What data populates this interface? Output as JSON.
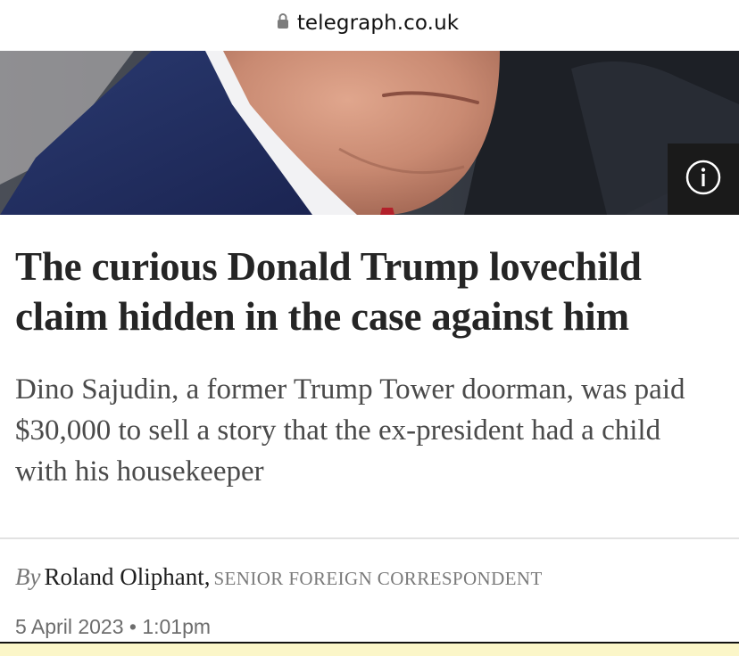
{
  "browser": {
    "url": "telegraph.co.uk"
  },
  "hero": {
    "image_icon": "info-icon"
  },
  "article": {
    "headline": "The curious Donald Trump lovechild claim hidden in the case against him",
    "standfirst": "Dino Sajudin, a former Trump Tower doorman, was paid $30,000 to sell a story that the ex-president had a child with his housekeeper",
    "byline_prefix": "By",
    "author": "Roland Oliphant,",
    "author_role": "Senior Foreign Correspondent",
    "date": "5 April 2023",
    "separator": " • ",
    "time": "1:01pm"
  },
  "colors": {
    "headline": "#252525",
    "standfirst": "#4a4a4a",
    "info_bg": "#1a1a1a",
    "bottom_strip": "#fbf6c8"
  }
}
